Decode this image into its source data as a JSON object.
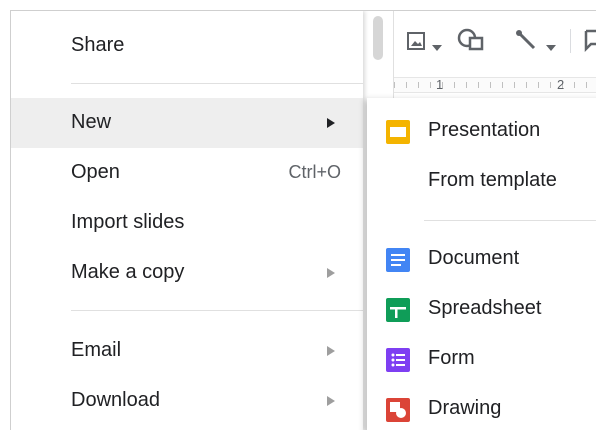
{
  "file_menu": {
    "items": [
      {
        "label": "Share",
        "shortcut": "",
        "has_submenu": false
      },
      {
        "label": "New",
        "shortcut": "",
        "has_submenu": true,
        "active": true
      },
      {
        "label": "Open",
        "shortcut": "Ctrl+O",
        "has_submenu": false
      },
      {
        "label": "Import slides",
        "shortcut": "",
        "has_submenu": false
      },
      {
        "label": "Make a copy",
        "shortcut": "",
        "has_submenu": true
      },
      {
        "label": "Email",
        "shortcut": "",
        "has_submenu": true
      },
      {
        "label": "Download",
        "shortcut": "",
        "has_submenu": true
      }
    ]
  },
  "new_submenu": {
    "items": [
      {
        "label": "Presentation",
        "icon": "slides-icon",
        "color": "#F4B400"
      },
      {
        "label": "From template",
        "icon": "",
        "color": ""
      },
      {
        "label": "Document",
        "icon": "docs-icon",
        "color": "#4285F4"
      },
      {
        "label": "Spreadsheet",
        "icon": "sheets-icon",
        "color": "#0F9D58"
      },
      {
        "label": "Form",
        "icon": "forms-icon",
        "color": "#7E3FF2"
      },
      {
        "label": "Drawing",
        "icon": "drawings-icon",
        "color": "#DB4437"
      }
    ]
  },
  "ruler": {
    "marks": [
      "1",
      "2"
    ]
  }
}
